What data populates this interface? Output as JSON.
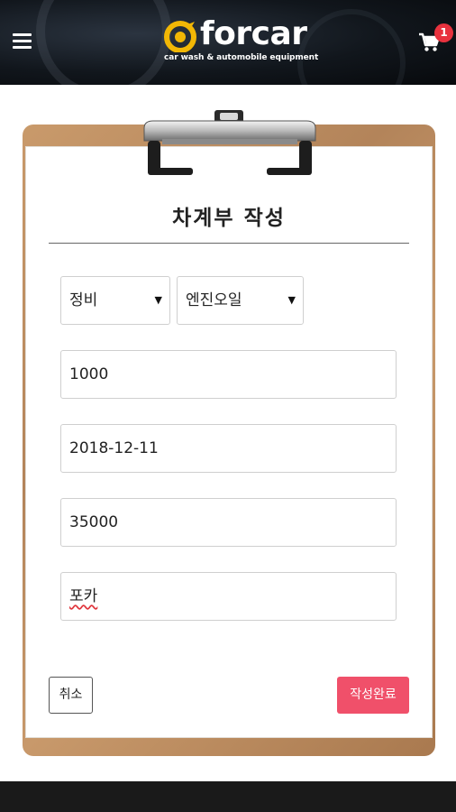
{
  "header": {
    "brand_name": "forcar",
    "brand_tagline": "car wash & automobile equipment",
    "menu_icon": "hamburger-menu-icon",
    "cart_icon": "shopping-cart-icon",
    "cart_count": "1"
  },
  "form": {
    "title": "차계부 작성",
    "category_select": "정비",
    "item_select": "엔진오일",
    "mileage": "1000",
    "date": "2018-12-11",
    "amount": "35000",
    "place": "포카",
    "cancel_label": "취소",
    "submit_label": "작성완료"
  },
  "colors": {
    "accent": "#f0506a",
    "badge": "#e8323e",
    "clipboard": "#c99a6b"
  }
}
